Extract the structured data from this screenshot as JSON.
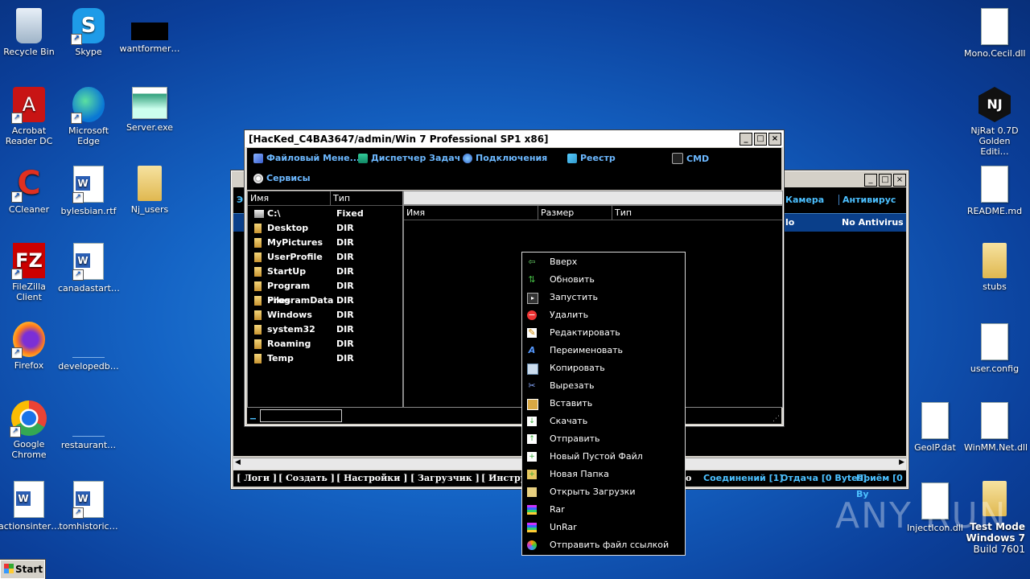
{
  "desktop": {
    "left_icons": [
      {
        "label": "Recycle Bin",
        "icon": "recycle-bin-icon"
      },
      {
        "label": "Skype",
        "icon": "skype-icon"
      },
      {
        "label": "wantformer…",
        "icon": "black-file-icon"
      },
      {
        "label": "Acrobat Reader DC",
        "icon": "acrobat-icon"
      },
      {
        "label": "Microsoft Edge",
        "icon": "edge-icon"
      },
      {
        "label": "Server.exe",
        "icon": "exe-icon"
      },
      {
        "label": "CCleaner",
        "icon": "ccleaner-icon"
      },
      {
        "label": "bylesbian.rtf",
        "icon": "word-doc-icon"
      },
      {
        "label": "Nj_users",
        "icon": "folder-icon"
      },
      {
        "label": "FileZilla Client",
        "icon": "filezilla-icon"
      },
      {
        "label": "canadastart…",
        "icon": "word-doc-icon"
      },
      {
        "label": "Firefox",
        "icon": "firefox-icon"
      },
      {
        "label": "developedb…",
        "icon": "blank-icon"
      },
      {
        "label": "Google Chrome",
        "icon": "chrome-icon"
      },
      {
        "label": "restaurant…",
        "icon": "blank-icon"
      },
      {
        "label": "actionsinter…",
        "icon": "word-doc-icon"
      },
      {
        "label": "tomhistoric…",
        "icon": "word-doc-icon"
      }
    ],
    "right_icons": [
      {
        "label": "Mono.Cecil.dll",
        "icon": "dll-icon"
      },
      {
        "label": "NjRat 0.7D Golden Editi…",
        "icon": "njrat-icon"
      },
      {
        "label": "README.md",
        "icon": "doc-icon"
      },
      {
        "label": "stubs",
        "icon": "folder-icon"
      },
      {
        "label": "user.config",
        "icon": "doc-icon"
      },
      {
        "label": "GeoIP.dat",
        "icon": "doc-icon"
      },
      {
        "label": "WinMM.Net.dll",
        "icon": "dll-icon"
      },
      {
        "label": "InjectIcon.dll",
        "icon": "dll-icon"
      }
    ],
    "test_mode": {
      "line1": "Test Mode",
      "line2": "Windows 7",
      "line3": "Build 7601"
    },
    "watermark": "ANY RUN",
    "start_label": "Start"
  },
  "back_window": {
    "columns": [
      "Э",
      "Камера",
      "Антивирус"
    ],
    "row": [
      "lo",
      "No Antivirus"
    ],
    "status_left": [
      "[ Логи ]",
      "[ Создать ]",
      "[ Настройки ]",
      "[ Загрузчик ]",
      "[ Инстру"
    ],
    "status_right": [
      "o",
      "Соединений [1]",
      "Отдача [0 Bytes]",
      "Приём [0 By"
    ]
  },
  "file_window": {
    "title": "[HacKed_C4BA3647/admin/Win 7 Professional SP1 x86]",
    "toolbar": [
      {
        "label": "Файловый Мене...",
        "icon": "file-manager-icon"
      },
      {
        "label": "Диспетчер Задач",
        "icon": "task-manager-icon"
      },
      {
        "label": "Подключения",
        "icon": "connections-icon"
      },
      {
        "label": "Реестр",
        "icon": "registry-icon"
      },
      {
        "label": "CMD",
        "icon": "cmd-icon"
      },
      {
        "label": "Сервисы",
        "icon": "services-icon"
      }
    ],
    "left_headers": [
      "Имя",
      "Тип"
    ],
    "dirs": [
      {
        "name": "C:\\",
        "type": "Fixed"
      },
      {
        "name": "Desktop",
        "type": "DIR"
      },
      {
        "name": "MyPictures",
        "type": "DIR"
      },
      {
        "name": "UserProfile",
        "type": "DIR"
      },
      {
        "name": "StartUp",
        "type": "DIR"
      },
      {
        "name": "Program Files",
        "type": "DIR"
      },
      {
        "name": "ProgramData",
        "type": "DIR"
      },
      {
        "name": "Windows",
        "type": "DIR"
      },
      {
        "name": "system32",
        "type": "DIR"
      },
      {
        "name": "Roaming",
        "type": "DIR"
      },
      {
        "name": "Temp",
        "type": "DIR"
      }
    ],
    "right_headers": [
      "Имя",
      "Размер",
      "Тип"
    ]
  },
  "context_menu": [
    {
      "label": "Вверх",
      "icon": "up-arrow-icon"
    },
    {
      "label": "Обновить",
      "icon": "refresh-icon"
    },
    {
      "label": "Запустить",
      "icon": "run-icon"
    },
    {
      "label": "Удалить",
      "icon": "delete-icon"
    },
    {
      "label": "Редактировать",
      "icon": "edit-icon"
    },
    {
      "label": "Переименовать",
      "icon": "rename-icon"
    },
    {
      "label": "Копировать",
      "icon": "copy-icon"
    },
    {
      "label": "Вырезать",
      "icon": "cut-icon"
    },
    {
      "label": "Вставить",
      "icon": "paste-icon"
    },
    {
      "label": "Скачать",
      "icon": "download-icon"
    },
    {
      "label": "Отправить",
      "icon": "upload-icon"
    },
    {
      "label": "Новый Пустой Файл",
      "icon": "new-file-icon"
    },
    {
      "label": "Новая Папка",
      "icon": "new-folder-icon"
    },
    {
      "label": "Открыть Загрузки",
      "icon": "open-downloads-icon"
    },
    {
      "label": "Rar",
      "icon": "rar-icon"
    },
    {
      "label": "UnRar",
      "icon": "unrar-icon"
    },
    {
      "label": "Отправить файл ссылкой",
      "icon": "send-link-icon"
    }
  ]
}
